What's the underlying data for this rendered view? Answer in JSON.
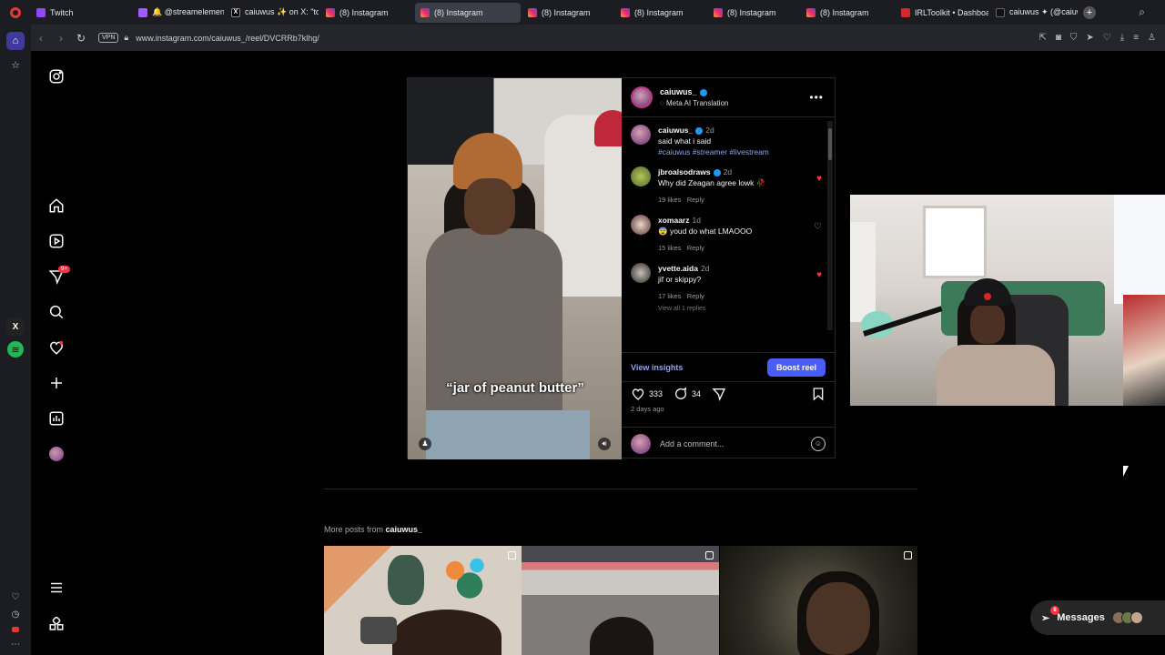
{
  "browser": {
    "tabs": [
      {
        "label": "Twitch",
        "icon": "twitch-icon",
        "active": false
      },
      {
        "label": "🔔 @streamelements",
        "icon": "streamelements-icon",
        "active": false
      },
      {
        "label": "caiuwus ✨ on X: \"toc",
        "icon": "x-icon",
        "active": false
      },
      {
        "label": "(8) Instagram",
        "icon": "instagram-icon",
        "active": false
      },
      {
        "label": "(8) Instagram",
        "icon": "instagram-icon",
        "active": true
      },
      {
        "label": "(8) Instagram",
        "icon": "instagram-icon",
        "active": false
      },
      {
        "label": "(8) Instagram",
        "icon": "instagram-icon",
        "active": false
      },
      {
        "label": "(8) Instagram",
        "icon": "instagram-icon",
        "active": false
      },
      {
        "label": "(8) Instagram",
        "icon": "instagram-icon",
        "active": false
      },
      {
        "label": "IRLToolkit • Dashboard",
        "icon": "irltoolkit-icon",
        "active": false
      },
      {
        "label": "caiuwus ✦ (@caiuwus",
        "icon": "tiktok-icon",
        "active": false
      }
    ],
    "vpn_label": "VPN",
    "url": "www.instagram.com/caiuwus_/reel/DVCRRb7klhg/"
  },
  "instagram_nav": {
    "notification_badge": "9+"
  },
  "post": {
    "caption_overlay": "“jar of peanut butter”",
    "author": "caiuwus_",
    "subtitle": "Meta AI Translation",
    "comments": [
      {
        "user": "caiuwus_",
        "time": "2d",
        "text": "said what i said",
        "tags": "#caiuwus #streamer #livestream",
        "verified": true
      },
      {
        "user": "jbroalsodraws",
        "time": "2d",
        "text": "Why did Zeagan agree lowk 🥀",
        "likes": "19 likes",
        "reply": "Reply",
        "liked": true,
        "verified": true
      },
      {
        "user": "xomaarz",
        "time": "1d",
        "text": "😨 youd do what LMAOOO",
        "likes": "15 likes",
        "reply": "Reply",
        "liked": false
      },
      {
        "user": "yvette.aida",
        "time": "2d",
        "text": "jif or skippy?",
        "likes": "17 likes",
        "reply": "Reply",
        "liked": true
      }
    ],
    "view_replies": "View all 1 replies",
    "view_insights": "View insights",
    "boost_label": "Boost reel",
    "like_count": "333",
    "comment_count": "34",
    "posted_ago": "2 days ago",
    "add_comment_placeholder": "Add a comment..."
  },
  "more_posts": {
    "prefix": "More posts from ",
    "user": "caiuwus_"
  },
  "messages": {
    "label": "Messages",
    "badge": "8"
  },
  "colors": {
    "accent_blue": "#4a5df9",
    "like_red": "#ff3040",
    "link_blue": "#8fa6e8"
  }
}
